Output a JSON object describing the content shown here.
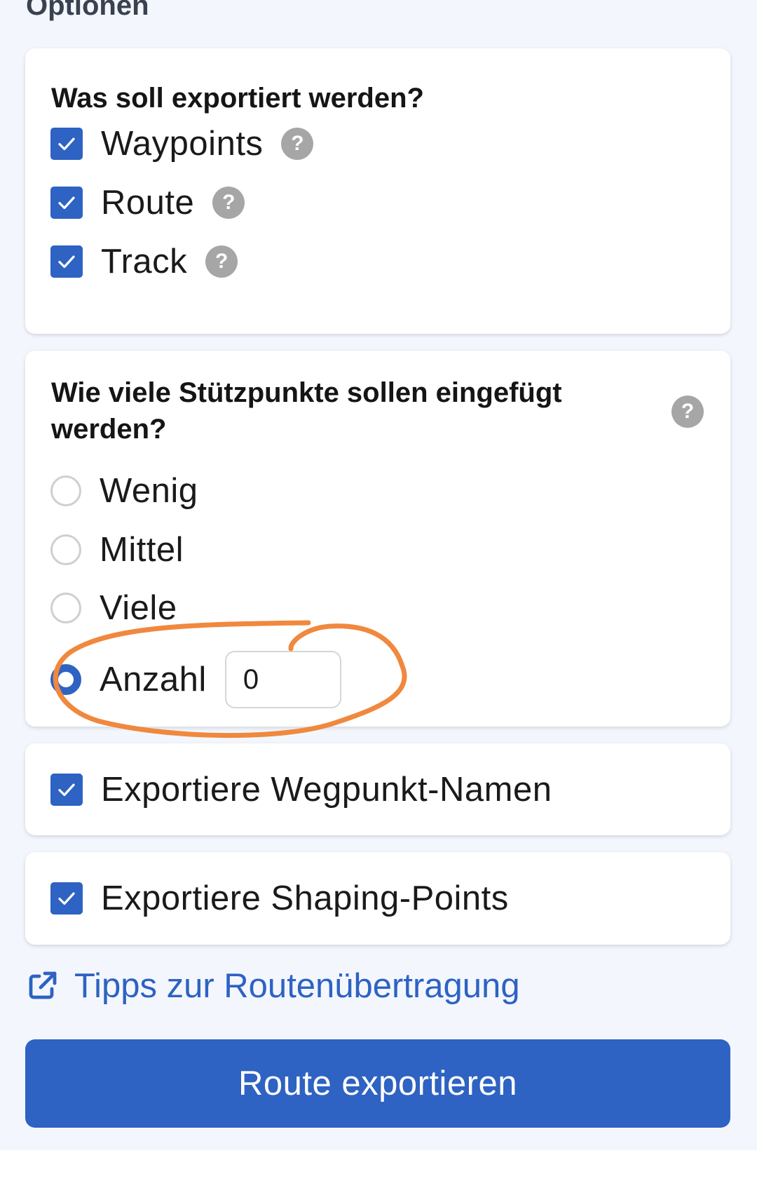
{
  "section": {
    "title": "Optionen"
  },
  "export_what": {
    "title": "Was soll exportiert werden?",
    "items": [
      {
        "label": "Waypoints",
        "checked": true,
        "help_icon": "question-circle-icon"
      },
      {
        "label": "Route",
        "checked": true,
        "help_icon": "question-circle-icon"
      },
      {
        "label": "Track",
        "checked": true,
        "help_icon": "question-circle-icon"
      }
    ]
  },
  "support_points": {
    "title": "Wie viele Stützpunkte sollen eingefügt werden?",
    "help_icon": "question-circle-icon",
    "options": [
      {
        "label": "Wenig",
        "selected": false
      },
      {
        "label": "Mittel",
        "selected": false
      },
      {
        "label": "Viele",
        "selected": false
      },
      {
        "label": "Anzahl",
        "selected": true
      }
    ],
    "count_value": "0"
  },
  "export_waypoint_names": {
    "label": "Exportiere Wegpunkt-Namen",
    "checked": true
  },
  "export_shaping_points": {
    "label": "Exportiere Shaping-Points",
    "checked": true
  },
  "tips_link": {
    "label": "Tipps zur Routenübertragung",
    "icon": "external-link-icon"
  },
  "export_button": {
    "label": "Route exportieren"
  },
  "colors": {
    "accent": "#2e62c3",
    "annotation": "#f0883e",
    "background": "#f3f7fd"
  }
}
